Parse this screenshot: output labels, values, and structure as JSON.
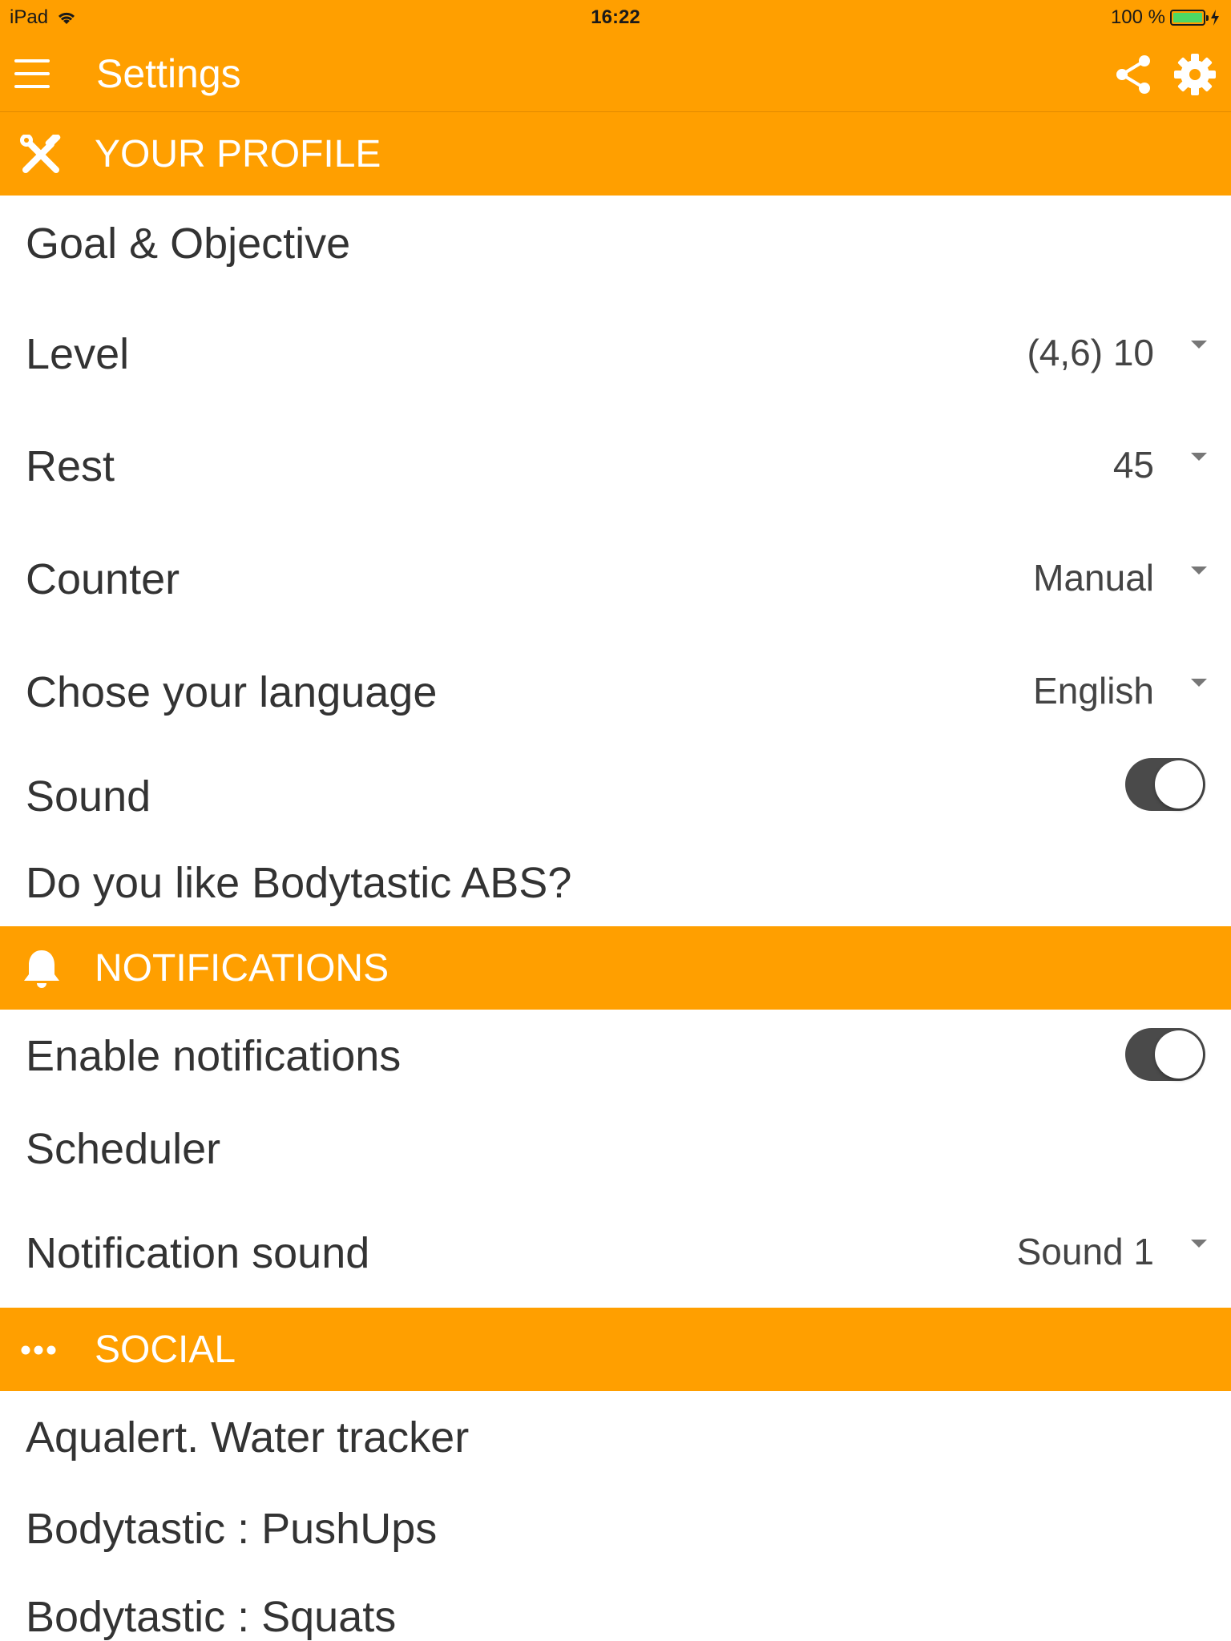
{
  "status_bar": {
    "device": "iPad",
    "time": "16:22",
    "battery": "100 %"
  },
  "app_bar": {
    "title": "Settings",
    "menu_icon": "menu-icon",
    "share_icon": "share-icon",
    "settings_icon": "gear-icon"
  },
  "sections": {
    "profile": {
      "title": "YOUR PROFILE",
      "icon": "tools-icon",
      "rows": {
        "goal": {
          "label": "Goal & Objective"
        },
        "level": {
          "label": "Level",
          "value": "(4,6) 10"
        },
        "rest": {
          "label": "Rest",
          "value": "45"
        },
        "counter": {
          "label": "Counter",
          "value": "Manual"
        },
        "language": {
          "label": "Chose your language",
          "value": "English"
        },
        "sound": {
          "label": "Sound",
          "toggle_on": true
        },
        "like": {
          "label": "Do you like Bodytastic ABS?"
        }
      }
    },
    "notifications": {
      "title": "NOTIFICATIONS",
      "icon": "bell-icon",
      "rows": {
        "enable": {
          "label": "Enable notifications",
          "toggle_on": true
        },
        "scheduler": {
          "label": "Scheduler"
        },
        "notification_sound": {
          "label": "Notification sound",
          "value": "Sound 1"
        }
      }
    },
    "social": {
      "title": "SOCIAL",
      "icon": "more-dots-icon",
      "rows": {
        "aqualert": {
          "label": "Aqualert. Water tracker"
        },
        "pushups": {
          "label": "Bodytastic : PushUps"
        },
        "squats": {
          "label": "Bodytastic : Squats"
        }
      }
    }
  },
  "colors": {
    "accent": "#ff9f00",
    "text": "#333333",
    "toggle_track": "#4a4a4a"
  }
}
